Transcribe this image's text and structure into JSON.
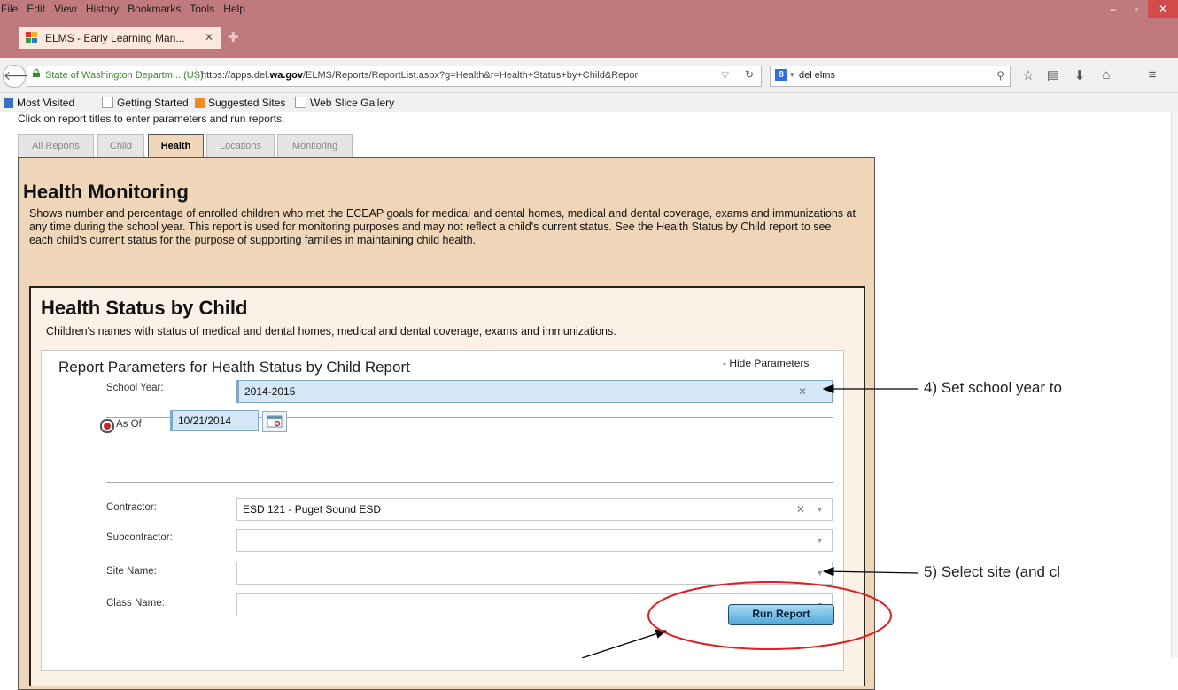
{
  "browser": {
    "menu": [
      "File",
      "Edit",
      "View",
      "History",
      "Bookmarks",
      "Tools",
      "Help"
    ],
    "tab_title": "ELMS - Early Learning Man...",
    "site_identity": "State of Washington Departm... (US)",
    "url_prefix": "https://apps.del.",
    "url_domain": "wa.gov",
    "url_suffix": "/ELMS/Reports/ReportList.aspx?g=Health&r=Health+Status+by+Child&Repor",
    "search_value": "del elms",
    "bookmarks": [
      "Most Visited",
      "Getting Started",
      "Suggested Sites",
      "Web Slice Gallery"
    ],
    "colors": {
      "chrome": "#c0797c",
      "close": "#d24a4a"
    }
  },
  "page": {
    "hint": "Click on report titles to enter parameters and run reports.",
    "tabs": [
      "All Reports",
      "Child",
      "Health",
      "Locations",
      "Monitoring"
    ],
    "active_tab": "Health",
    "section_title": "Health Monitoring",
    "section_desc": "Shows number and percentage of enrolled children who met the ECEAP goals for medical and dental homes, medical and dental coverage, exams and immunizations at any time during the school year. This report is used for monitoring purposes and may not reflect a child's current status. See the Health Status by Child report to see each child's current status for the purpose of supporting families in maintaining child health.",
    "report_title": "Health Status by Child",
    "report_desc": "Children's names with status of medical and dental homes, medical and dental coverage, exams and immunizations.",
    "params": {
      "title": "Report Parameters for Health Status by Child Report",
      "hide_label": "- Hide Parameters",
      "school_year_label": "School Year:",
      "school_year_value": "2014-2015",
      "as_of_label": "As Of",
      "as_of_value": "10/21/2014",
      "contractor_label": "Contractor:",
      "contractor_value": "ESD 121 - Puget Sound ESD",
      "subcontractor_label": "Subcontractor:",
      "subcontractor_value": "",
      "site_label": "Site Name:",
      "site_value": "",
      "class_label": "Class Name:",
      "class_value": "",
      "run_button": "Run Report"
    }
  },
  "annotations": {
    "step4": "4) Set school year to",
    "step5": "5) Select site (and cl"
  }
}
